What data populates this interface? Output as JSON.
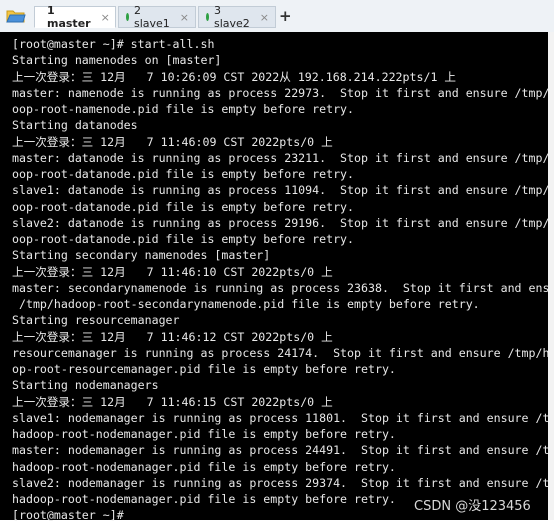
{
  "tabs": [
    {
      "label": "1 master",
      "dot_color": "#2ea043",
      "active": true
    },
    {
      "label": "2 slave1",
      "dot_color": "#2ea043",
      "active": false
    },
    {
      "label": "3 slave2",
      "dot_color": "#2ea043",
      "active": false
    }
  ],
  "tab_close_glyph": "×",
  "add_tab_glyph": "+",
  "terminal": {
    "lines": [
      "[root@master ~]# start-all.sh",
      "Starting namenodes on [master]",
      "上一次登录：三 12月   7 10:26:09 CST 2022从 192.168.214.222pts/1 上",
      "master: namenode is running as process 22973.  Stop it first and ensure /tmp/had",
      "oop-root-namenode.pid file is empty before retry.",
      "Starting datanodes",
      "上一次登录：三 12月   7 11:46:09 CST 2022pts/0 上",
      "master: datanode is running as process 23211.  Stop it first and ensure /tmp/had",
      "oop-root-datanode.pid file is empty before retry.",
      "slave1: datanode is running as process 11094.  Stop it first and ensure /tmp/had",
      "oop-root-datanode.pid file is empty before retry.",
      "slave2: datanode is running as process 29196.  Stop it first and ensure /tmp/had",
      "oop-root-datanode.pid file is empty before retry.",
      "Starting secondary namenodes [master]",
      "上一次登录：三 12月   7 11:46:10 CST 2022pts/0 上",
      "master: secondarynamenode is running as process 23638.  Stop it first and ensure",
      " /tmp/hadoop-root-secondarynamenode.pid file is empty before retry.",
      "Starting resourcemanager",
      "上一次登录：三 12月   7 11:46:12 CST 2022pts/0 上",
      "resourcemanager is running as process 24174.  Stop it first and ensure /tmp/hado",
      "op-root-resourcemanager.pid file is empty before retry.",
      "Starting nodemanagers",
      "上一次登录：三 12月   7 11:46:15 CST 2022pts/0 上",
      "slave1: nodemanager is running as process 11801.  Stop it first and ensure /tmp/",
      "hadoop-root-nodemanager.pid file is empty before retry.",
      "master: nodemanager is running as process 24491.  Stop it first and ensure /tmp/",
      "hadoop-root-nodemanager.pid file is empty before retry.",
      "slave2: nodemanager is running as process 29374.  Stop it first and ensure /tmp/",
      "hadoop-root-nodemanager.pid file is empty before retry.",
      "[root@master ~]#"
    ]
  },
  "watermark": "CSDN @没123456",
  "colors": {
    "terminal_bg": "#000000",
    "terminal_fg": "#e8e8e8",
    "tab_dot": "#2ea043"
  }
}
